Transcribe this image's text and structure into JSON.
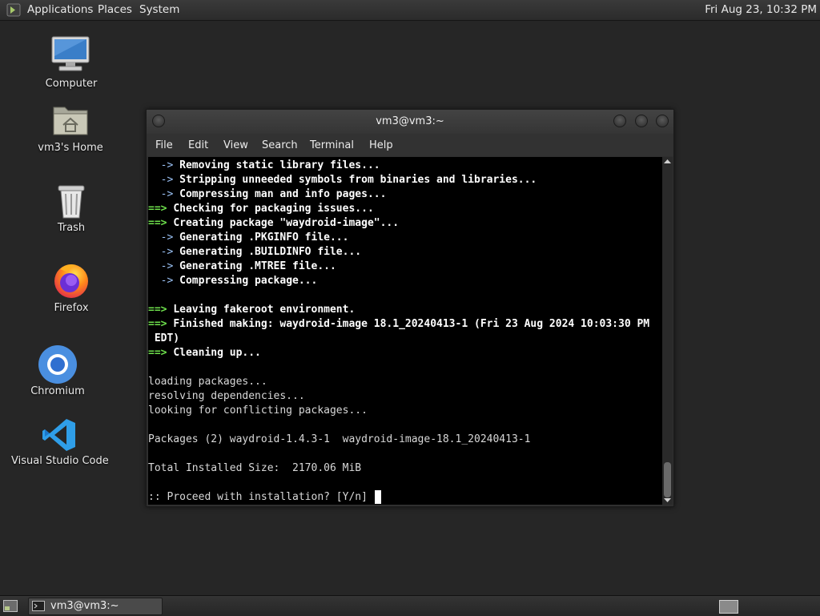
{
  "top_panel": {
    "menus": [
      "Applications",
      "Places",
      "System"
    ],
    "clock": "Fri Aug 23, 10:32 PM"
  },
  "desktop": {
    "icons": [
      {
        "label": "Computer",
        "icon": "computer-icon"
      },
      {
        "label": "vm3's Home",
        "icon": "home-folder-icon"
      },
      {
        "label": "Trash",
        "icon": "trash-icon"
      },
      {
        "label": "Firefox",
        "icon": "firefox-icon"
      },
      {
        "label": "Chromium",
        "icon": "chromium-icon"
      },
      {
        "label": "Visual Studio Code",
        "icon": "vscode-icon"
      }
    ]
  },
  "terminal": {
    "title": "vm3@vm3:~",
    "menu": [
      "File",
      "Edit",
      "View",
      "Search",
      "Terminal",
      "Help"
    ],
    "lines": [
      {
        "prefix": "  -> ",
        "text": "Removing static library files...",
        "style": "sub"
      },
      {
        "prefix": "  -> ",
        "text": "Stripping unneeded symbols from binaries and libraries...",
        "style": "sub"
      },
      {
        "prefix": "  -> ",
        "text": "Compressing man and info pages...",
        "style": "sub"
      },
      {
        "prefix": "==> ",
        "text": "Checking for packaging issues...",
        "style": "main"
      },
      {
        "prefix": "==> ",
        "text": "Creating package \"waydroid-image\"...",
        "style": "main"
      },
      {
        "prefix": "  -> ",
        "text": "Generating .PKGINFO file...",
        "style": "sub"
      },
      {
        "prefix": "  -> ",
        "text": "Generating .BUILDINFO file...",
        "style": "sub"
      },
      {
        "prefix": "  -> ",
        "text": "Generating .MTREE file...",
        "style": "sub"
      },
      {
        "prefix": "  -> ",
        "text": "Compressing package...",
        "style": "sub"
      },
      {
        "prefix": "",
        "text": "",
        "style": "plain"
      },
      {
        "prefix": "==> ",
        "text": "Leaving fakeroot environment.",
        "style": "main"
      },
      {
        "prefix": "==> ",
        "text": "Finished making: waydroid-image 18.1_20240413-1 (Fri 23 Aug 2024 10:03:30 PM",
        "style": "main"
      },
      {
        "prefix": "",
        "text": " EDT)",
        "style": "boldonly"
      },
      {
        "prefix": "==> ",
        "text": "Cleaning up...",
        "style": "main"
      },
      {
        "prefix": "",
        "text": "",
        "style": "plain"
      },
      {
        "prefix": "",
        "text": "loading packages...",
        "style": "plain"
      },
      {
        "prefix": "",
        "text": "resolving dependencies...",
        "style": "plain"
      },
      {
        "prefix": "",
        "text": "looking for conflicting packages...",
        "style": "plain"
      },
      {
        "prefix": "",
        "text": "",
        "style": "plain"
      },
      {
        "prefix": "",
        "text": "Packages (2) waydroid-1.4.3-1  waydroid-image-18.1_20240413-1",
        "style": "plain"
      },
      {
        "prefix": "",
        "text": "",
        "style": "plain"
      },
      {
        "prefix": "",
        "text": "Total Installed Size:  2170.06 MiB",
        "style": "plain"
      },
      {
        "prefix": "",
        "text": "",
        "style": "plain"
      },
      {
        "prefix": "",
        "text": ":: Proceed with installation? [Y/n] ",
        "style": "plain"
      }
    ]
  },
  "bottom_panel": {
    "task_label": "vm3@vm3:~"
  }
}
